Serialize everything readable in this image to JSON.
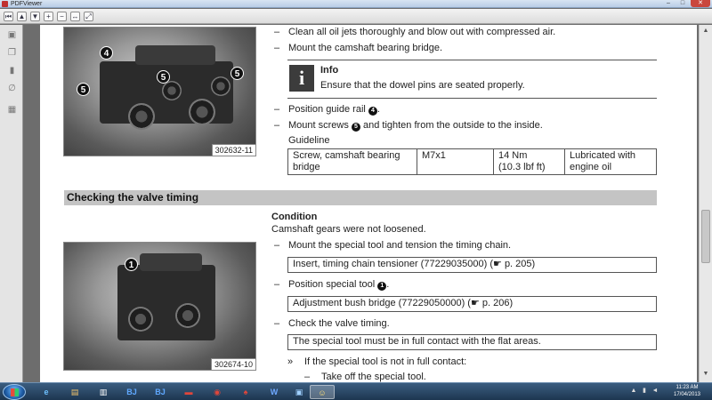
{
  "window": {
    "title": "PDFViewer",
    "minimize": "–",
    "maximize": "□",
    "close": "✕"
  },
  "toolbar": {
    "buttons": [
      {
        "name": "first-page",
        "glyph": "⏮"
      },
      {
        "name": "prev-page",
        "glyph": "▲"
      },
      {
        "name": "next-page",
        "glyph": "▼"
      },
      {
        "name": "zoom-in",
        "glyph": "+"
      },
      {
        "name": "zoom-out",
        "glyph": "−"
      },
      {
        "name": "fit-width",
        "glyph": "↔"
      },
      {
        "name": "fit-page",
        "glyph": "⤢"
      }
    ]
  },
  "figure1": {
    "caption": "302632-11",
    "callouts": [
      "4",
      "5",
      "5",
      "5"
    ]
  },
  "figure2": {
    "caption": "302674-10",
    "callouts": [
      "1"
    ]
  },
  "steps_top": {
    "step1": "Clean all oil jets thoroughly and blow out with compressed air.",
    "step2": "Mount the camshaft bearing bridge.",
    "info_title": "Info",
    "info_text": "Ensure that the dowel pins are seated properly.",
    "step3_prefix": "Position guide rail",
    "step3_badge": "4",
    "step3_suffix": ".",
    "step4_prefix": "Mount screws",
    "step4_badge": "5",
    "step4_suffix": "and tighten from the outside to the inside.",
    "guideline": "Guideline"
  },
  "spec_table": {
    "col1_line1": "Screw, camshaft bearing",
    "col1_line2": "bridge",
    "col2": "M7x1",
    "col3_line1": "14 Nm",
    "col3_line2": "(10.3 lbf ft)",
    "col4_line1": "Lubricated with",
    "col4_line2": "engine oil"
  },
  "section": {
    "title": "Checking the valve timing"
  },
  "steps_bottom": {
    "condition_title": "Condition",
    "condition_text": "Camshaft gears were not loosened.",
    "step1": "Mount the special tool and tension the timing chain.",
    "box1": "Insert, timing chain tensioner (77229035000) (☛ p. 205)",
    "step2_prefix": "Position special tool",
    "step2_badge": "1",
    "step2_suffix": ".",
    "box2": "Adjustment bush bridge (77229050000) (☛ p. 206)",
    "step3": "Check the valve timing.",
    "box3": "The special tool must be in full contact with the flat areas.",
    "sub1": "If the special tool is not in full contact:",
    "sub2": "Take off the special tool."
  },
  "taskbar": {
    "apps": [
      {
        "name": "internet-explorer",
        "label": "e"
      },
      {
        "name": "file-explorer",
        "label": "▤"
      },
      {
        "name": "documents",
        "label": "▥"
      },
      {
        "name": "bj-app-1",
        "label": "BJ"
      },
      {
        "name": "bj-app-2",
        "label": "BJ"
      },
      {
        "name": "media-app",
        "label": "▬"
      },
      {
        "name": "browser-app",
        "label": "◉"
      },
      {
        "name": "pdf-app",
        "label": "♠"
      },
      {
        "name": "word-app",
        "label": "W"
      },
      {
        "name": "news-app",
        "label": "▣"
      },
      {
        "name": "pdfviewer-app",
        "label": "☺"
      }
    ],
    "time": "11:23 AM",
    "date": "17/04/2013"
  }
}
